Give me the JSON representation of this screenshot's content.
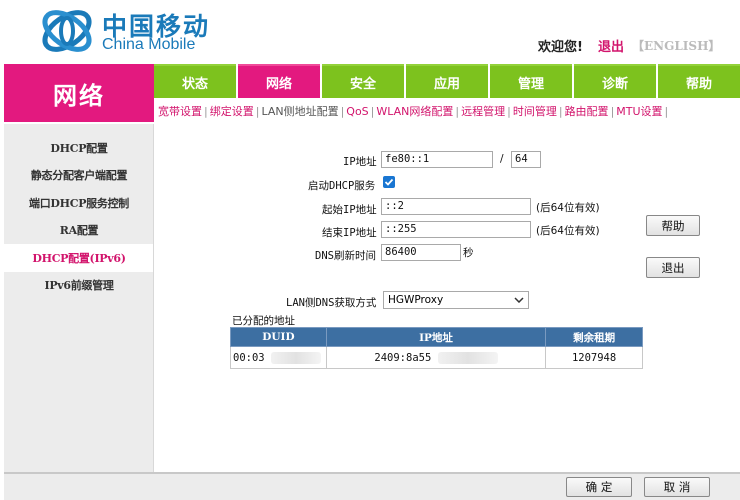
{
  "header": {
    "logo_cn": "中国移动",
    "logo_en": "China Mobile",
    "welcome": "欢迎您!",
    "logout": "退出",
    "english": "【ENGLISH】"
  },
  "nav": {
    "section_title": "网络",
    "tabs": [
      "状态",
      "网络",
      "安全",
      "应用",
      "管理",
      "诊断",
      "帮助"
    ],
    "active_tab": "网络",
    "sub_tabs": [
      "宽带设置",
      "绑定设置",
      "LAN侧地址配置",
      "QoS",
      "WLAN网络配置",
      "远程管理",
      "时间管理",
      "路由配置",
      "MTU设置"
    ],
    "active_sub_tab": "LAN侧地址配置"
  },
  "sidebar": {
    "items": [
      "DHCP配置",
      "静态分配客户端配置",
      "端口DHCP服务控制",
      "RA配置",
      "DHCP配置(IPv6)",
      "IPv6前缀管理"
    ],
    "active": "DHCP配置(IPv6)"
  },
  "form": {
    "ip_label": "IP地址",
    "ip_value": "fe80::1",
    "slash": "/",
    "prefix_value": "64",
    "dhcp_label": "启动DHCP服务",
    "dhcp_enabled": true,
    "start_label": "起始IP地址",
    "start_value": "::2",
    "start_note": "(后64位有效)",
    "end_label": "结束IP地址",
    "end_value": "::255",
    "end_note": "(后64位有效)",
    "dns_refresh_label": "DNS刷新时间",
    "dns_refresh_value": "86400",
    "dns_refresh_unit": "秒",
    "dns_mode_label": "LAN侧DNS获取方式",
    "dns_mode_value": "HGWProxy",
    "help_button": "帮助",
    "exit_button": "退出"
  },
  "leases": {
    "title": "已分配的地址",
    "columns": [
      "DUID",
      "IP地址",
      "剩余租期"
    ],
    "rows": [
      {
        "duid": "00:03",
        "ip": "2409:8a55",
        "lease": "1207948"
      }
    ]
  },
  "footer": {
    "ok_button": "确 定",
    "cancel_button": "取 消"
  }
}
